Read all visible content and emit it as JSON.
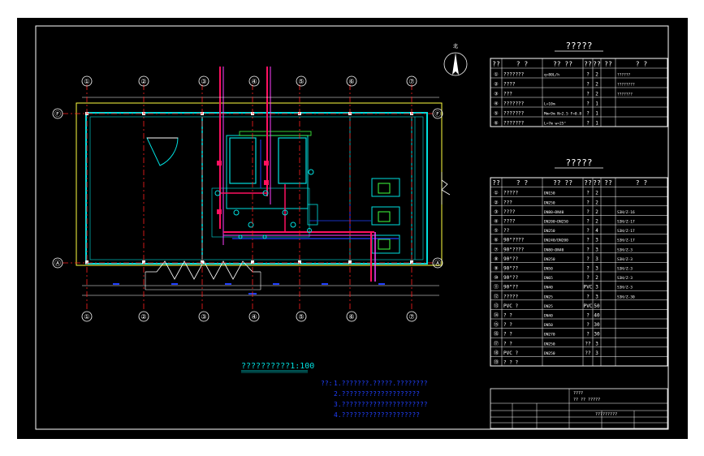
{
  "drawing": {
    "title": "??????????1:100",
    "north_label": "北",
    "notes_prefix": "??:",
    "notes": [
      "1.???????.?????.????????",
      "2.????????????????????",
      "3.??????????????????????",
      "4.????????????????????"
    ],
    "axis_numbers": [
      "①",
      "②",
      "③",
      "④",
      "⑤",
      "⑥",
      "⑦"
    ],
    "axis_letters": [
      "Ⓕ",
      "Ⓐ"
    ]
  },
  "table1": {
    "title": "?????",
    "headers": [
      "??",
      "?  ?",
      "??  ??",
      "??",
      "??",
      "??",
      "? ?"
    ],
    "rows": [
      {
        "no": "①",
        "name": "???????",
        "spec": "q=80L/h",
        "unit": "?",
        "qty": "2",
        "note": "??????"
      },
      {
        "no": "②",
        "name": "????",
        "spec": "",
        "unit": "?",
        "qty": "2",
        "note": "????????"
      },
      {
        "no": "③",
        "name": "???",
        "spec": "",
        "unit": "?",
        "qty": "2",
        "note": "???????"
      },
      {
        "no": "④",
        "name": "???????",
        "spec": "L=10m",
        "unit": "?",
        "qty": "1",
        "note": ""
      },
      {
        "no": "⑤",
        "name": "???????",
        "spec": "Mm=9m N=2.5 F=0.8",
        "unit": "?",
        "qty": "1",
        "note": ""
      },
      {
        "no": "⑥",
        "name": "???????",
        "spec": "L=7m w=25°",
        "unit": "?",
        "qty": "1",
        "note": ""
      }
    ]
  },
  "table2": {
    "title": "?????",
    "headers": [
      "??",
      "?  ?",
      "??  ??",
      "??",
      "??",
      "??",
      "? ?"
    ],
    "rows": [
      {
        "no": "①",
        "name": "?????",
        "spec": "DN150",
        "unit": "?",
        "qty": "2",
        "note": ""
      },
      {
        "no": "②",
        "name": "???",
        "spec": "DN250",
        "unit": "?",
        "qty": "2",
        "note": ""
      },
      {
        "no": "③",
        "name": "????",
        "spec": "DN80~DN40",
        "unit": "?",
        "qty": "2",
        "note": "S3H/Z-16"
      },
      {
        "no": "④",
        "name": "????",
        "spec": "DN200~DN250",
        "unit": "?",
        "qty": "2",
        "note": "S3H/Z-17"
      },
      {
        "no": "⑤",
        "name": "??",
        "spec": "DN250",
        "unit": "?",
        "qty": "4",
        "note": "S3H/Z-17"
      },
      {
        "no": "⑥",
        "name": "90°????",
        "spec": "DN240/DN200",
        "unit": "?",
        "qty": "3",
        "note": "S3H/Z-17"
      },
      {
        "no": "⑦",
        "name": "90°????",
        "spec": "DN80~DN40",
        "unit": "?",
        "qty": "3",
        "note": "S3H/Z-3"
      },
      {
        "no": "⑧",
        "name": "90°??",
        "spec": "DN250",
        "unit": "?",
        "qty": "3",
        "note": "S3H/Z-3"
      },
      {
        "no": "⑨",
        "name": "90°??",
        "spec": "DN50",
        "unit": "?",
        "qty": "3",
        "note": "S3H/Z-3"
      },
      {
        "no": "⑩",
        "name": "90°??",
        "spec": "DN65",
        "unit": "?",
        "qty": "2",
        "note": "S3H/Z-3"
      },
      {
        "no": "⑪",
        "name": "90°??",
        "spec": "DN40",
        "unit": "PVC",
        "qty": "3",
        "note": "S3H/Z-3"
      },
      {
        "no": "⑫",
        "name": "?????",
        "spec": "DN25",
        "unit": "?",
        "qty": "3",
        "note": "S3H/Z-30"
      },
      {
        "no": "⑬",
        "name": "PVC ?",
        "spec": "DN25",
        "unit": "PVC",
        "qty": "50",
        "note": ""
      },
      {
        "no": "⑭",
        "name": "?  ?",
        "spec": "DN40",
        "unit": "?",
        "qty": "40",
        "note": ""
      },
      {
        "no": "⑮",
        "name": "?  ?",
        "spec": "DN50",
        "unit": "?",
        "qty": "30",
        "note": ""
      },
      {
        "no": "⑯",
        "name": "?  ?",
        "spec": "DN270",
        "unit": "?",
        "qty": "30",
        "note": ""
      },
      {
        "no": "⑰",
        "name": "?  ?",
        "spec": "DN250",
        "unit": "??",
        "qty": "3",
        "note": ""
      },
      {
        "no": "⑱",
        "name": "PVC ?",
        "spec": "DN250",
        "unit": "??",
        "qty": "3",
        "note": ""
      },
      {
        "no": "⑲",
        "name": "? ? ?",
        "spec": "",
        "unit": "",
        "qty": "",
        "note": ""
      }
    ]
  },
  "titleblock": {
    "line1": "????",
    "line2": "?? ?? ?????",
    "line3": "?????????"
  },
  "colors": {
    "background": "#000000",
    "frame": "#ffffff",
    "wall": "#00e0e0",
    "axis": "#ff2020",
    "pipe_red": "#ff1060",
    "pipe_magenta": "#ff40ff",
    "yellow": "#ffff40",
    "blue": "#2040ff",
    "green": "#40ff40"
  }
}
